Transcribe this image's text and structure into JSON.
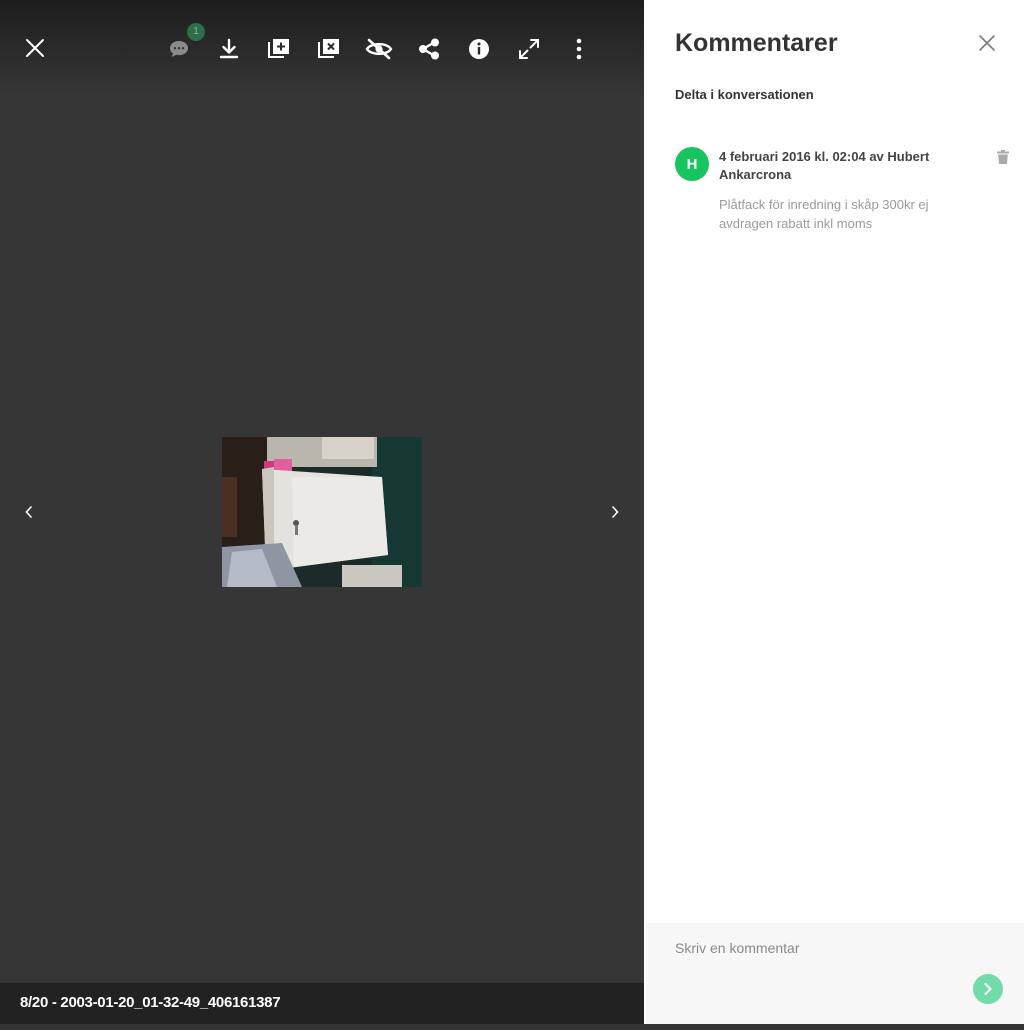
{
  "viewer": {
    "toolbar": {
      "close_icon": "close-icon",
      "comments_icon": "comment-icon",
      "comments_count": "1",
      "download_icon": "download-icon",
      "add_to_album_icon": "add-to-album-icon",
      "remove_from_album_icon": "remove-from-album-icon",
      "hide_icon": "hide-icon",
      "share_icon": "share-icon",
      "info_icon": "info-icon",
      "fullscreen_icon": "fullscreen-icon",
      "more_icon": "more-vertical-icon"
    },
    "caption": "8/20 - 2003-01-20_01-32-49_406161387",
    "colors": {
      "background": "#363636",
      "caption_bar": "#222222",
      "badge": "#2f6d4c"
    }
  },
  "comments": {
    "title": "Kommentarer",
    "join_label": "Delta i konversationen",
    "items": [
      {
        "avatar_letter": "H",
        "meta": "4 februari 2016 kl. 02:04 av Hubert Ankarcrona",
        "text": "Plåtfack för inredning i skåp 300kr ej avdragen rabatt inkl moms"
      }
    ],
    "composer": {
      "placeholder": "Skriv en kommentar"
    },
    "colors": {
      "avatar": "#17c45f",
      "send_button": "#71dba9"
    }
  }
}
